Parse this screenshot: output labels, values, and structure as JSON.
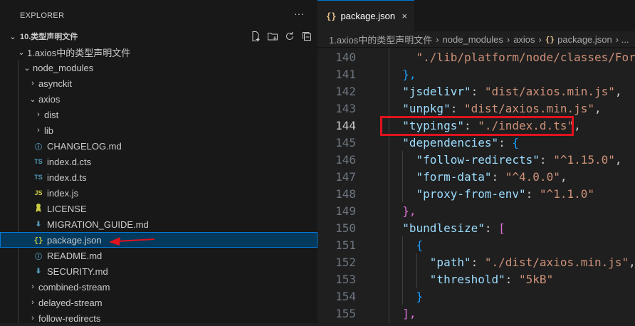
{
  "explorer": {
    "title": "EXPLORER",
    "more": "···",
    "root": "10.类型声明文件",
    "items": [
      {
        "label": "1.axios中的类型声明文件",
        "kind": "folder-open",
        "depth": 1
      },
      {
        "label": "node_modules",
        "kind": "folder-open",
        "depth": 2
      },
      {
        "label": "asynckit",
        "kind": "folder",
        "depth": 3
      },
      {
        "label": "axios",
        "kind": "folder-open",
        "depth": 3
      },
      {
        "label": "dist",
        "kind": "folder",
        "depth": 4
      },
      {
        "label": "lib",
        "kind": "folder",
        "depth": 4
      },
      {
        "label": "CHANGELOG.md",
        "kind": "info",
        "depth": 4
      },
      {
        "label": "index.d.cts",
        "kind": "ts",
        "depth": 4
      },
      {
        "label": "index.d.ts",
        "kind": "ts",
        "depth": 4
      },
      {
        "label": "index.js",
        "kind": "js",
        "depth": 4
      },
      {
        "label": "LICENSE",
        "kind": "license",
        "depth": 4
      },
      {
        "label": "MIGRATION_GUIDE.md",
        "kind": "markdown",
        "depth": 4
      },
      {
        "label": "package.json",
        "kind": "json",
        "depth": 4,
        "selected": true
      },
      {
        "label": "README.md",
        "kind": "info",
        "depth": 4
      },
      {
        "label": "SECURITY.md",
        "kind": "markdown",
        "depth": 4
      },
      {
        "label": "combined-stream",
        "kind": "folder",
        "depth": 3
      },
      {
        "label": "delayed-stream",
        "kind": "folder",
        "depth": 3
      },
      {
        "label": "follow-redirects",
        "kind": "folder",
        "depth": 3
      }
    ]
  },
  "editor": {
    "tab": {
      "braces": "{}",
      "label": "package.json",
      "close": "×"
    },
    "breadcrumb": [
      "1.axios中的类型声明文件",
      "node_modules",
      "axios"
    ],
    "breadcrumb_file": "package.json",
    "breadcrumb_more": "› ...",
    "lines": [
      {
        "n": "140",
        "text": "    \"./lib/platform/node/classes/FormData.js\""
      },
      {
        "n": "141",
        "text": "  },"
      },
      {
        "n": "142",
        "text": "  \"jsdelivr\": \"dist/axios.min.js\","
      },
      {
        "n": "143",
        "text": "  \"unpkg\": \"dist/axios.min.js\","
      },
      {
        "n": "144",
        "text": "  \"typings\": \"./index.d.ts\",",
        "active": true
      },
      {
        "n": "145",
        "text": "  \"dependencies\": {"
      },
      {
        "n": "146",
        "text": "    \"follow-redirects\": \"^1.15.0\","
      },
      {
        "n": "147",
        "text": "    \"form-data\": \"^4.0.0\","
      },
      {
        "n": "148",
        "text": "    \"proxy-from-env\": \"^1.1.0\""
      },
      {
        "n": "149",
        "text": "  },"
      },
      {
        "n": "150",
        "text": "  \"bundlesize\": ["
      },
      {
        "n": "151",
        "text": "    {"
      },
      {
        "n": "152",
        "text": "      \"path\": \"./dist/axios.min.js\","
      },
      {
        "n": "153",
        "text": "      \"threshold\": \"5kB\""
      },
      {
        "n": "154",
        "text": "    }"
      },
      {
        "n": "155",
        "text": "  ],"
      }
    ]
  },
  "colors": {
    "highlight_box": "#e0131e",
    "arrow": "#e0131e",
    "selection": "#04395e"
  }
}
